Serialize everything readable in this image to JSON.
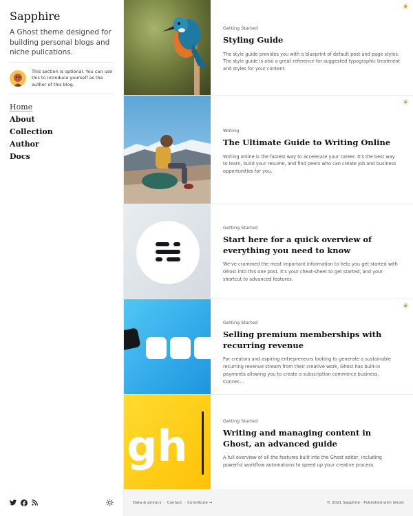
{
  "site": {
    "title": "Sapphire",
    "description": "A Ghost theme designed for building personal blogs and niche pulications.",
    "author_note": "This section is optional. You can use this to introduce yourself as the author of this blog."
  },
  "nav": [
    {
      "label": "Home",
      "active": true
    },
    {
      "label": "About"
    },
    {
      "label": "Collection"
    },
    {
      "label": "Author"
    },
    {
      "label": "Docs"
    }
  ],
  "icons": {
    "twitter": "twitter-icon",
    "facebook": "facebook-icon",
    "rss": "rss-icon",
    "theme_toggle": "sun-icon",
    "lock": "lock-icon"
  },
  "posts": [
    {
      "tag": "Getting Started",
      "title": "Styling Guide",
      "excerpt": "The style guide provides you with a blueprint of default post and page styles. The style guide is also a great reference for suggested typographic treatment and styles for your content.",
      "members_only": true
    },
    {
      "tag": "Writing",
      "title": "The Ultimate Guide to Writing Online",
      "excerpt": "Writing online is the fastest way to accelerate your career. It's the best way to learn, build your resume, and find peers who can create job and business opportunities for you.",
      "members_only": true
    },
    {
      "tag": "Getting Started",
      "title": "Start here for a quick overview of everything you need to know",
      "excerpt": "We've crammed the most important information to help you get started with Ghost into this one post. It's your cheat-sheet to get started, and your shortcut to advanced features.",
      "members_only": false
    },
    {
      "tag": "Getting Started",
      "title": "Selling premium memberships with recurring revenue",
      "excerpt": "For creators and aspiring entrepreneurs looking to generate a sustainable recurring revenue stream from their creative work, Ghost has built-in payments allowing you to create a subscription commerce business. Connec...",
      "members_only": true
    },
    {
      "tag": "Getting Started",
      "title": "Writing and managing content in Ghost, an advanced guide",
      "excerpt": "A full overview of all the features built into the Ghost editor, including powerful workflow automations to speed up your creative process.",
      "members_only": false
    }
  ],
  "images": {
    "ghost_logo_text": "gh"
  },
  "footer": {
    "links": [
      "Data & privacy",
      "Contact",
      "Contribute →"
    ],
    "separator": "·",
    "copyright": "© 2021 Sapphire · Published with Ghost"
  },
  "colors": {
    "accent_blue": "#2aa7ec",
    "accent_yellow": "#ffd21c"
  }
}
